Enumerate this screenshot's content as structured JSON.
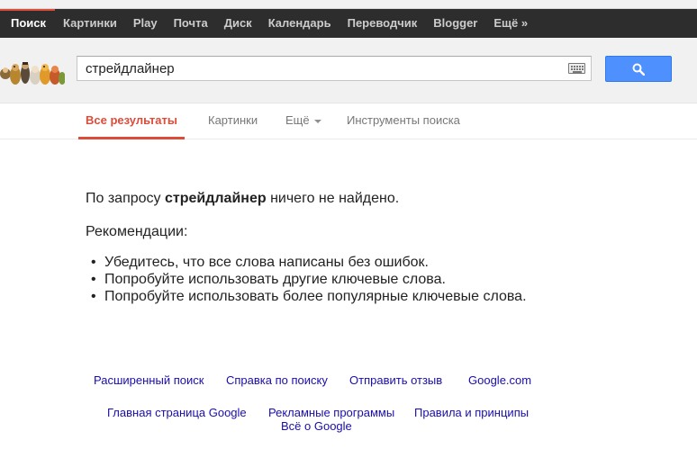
{
  "topbar": {
    "items": [
      "Поиск",
      "Картинки",
      "Play",
      "Почта",
      "Диск",
      "Календарь",
      "Переводчик",
      "Blogger",
      "Ещё »"
    ]
  },
  "search": {
    "query": "стрейдлайнер"
  },
  "tabs": {
    "all": "Все результаты",
    "images": "Картинки",
    "more": "Ещё",
    "tools": "Инструменты поиска"
  },
  "results": {
    "prefix": "По запросу ",
    "query": "стрейдлайнер",
    "suffix": " ничего не найдено.",
    "recommendations_title": "Рекомендации:",
    "recommendations": [
      "Убедитесь, что все слова написаны без ошибок.",
      "Попробуйте использовать другие ключевые слова.",
      "Попробуйте использовать более популярные ключевые слова."
    ],
    "bullet": "•"
  },
  "footer": {
    "advanced_search": "Расширенный поиск",
    "search_help": "Справка по поиску",
    "send_feedback": "Отправить отзыв",
    "google_com": "Google.com",
    "google_home": "Главная страница Google",
    "advertising": "Рекламные программы",
    "privacy_terms": "Правила и принципы",
    "about_google": "Всё о Google"
  },
  "colors": {
    "accent_red": "#dd4b39",
    "search_button_blue": "#4d90fe",
    "link_blue": "#1a0dab",
    "topbar_bg": "#2d2d2d"
  },
  "icons": {
    "search_button": "magnifier-icon",
    "keyboard": "keyboard-icon",
    "more_tab": "caret-down-icon",
    "logo": "google-doodle-logo"
  }
}
